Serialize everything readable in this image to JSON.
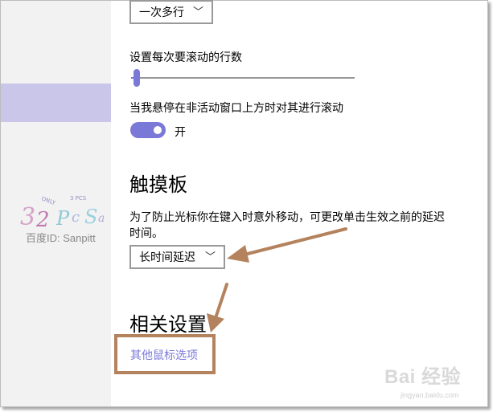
{
  "scrolling": {
    "lines_mode_value": "一次多行",
    "lines_label": "设置每次要滚动的行数",
    "lines_slider_value": 0.03,
    "inactive_scroll_label": "当我悬停在非活动窗口上方时对其进行滚动",
    "inactive_scroll_state": "开"
  },
  "touchpad": {
    "heading": "触摸板",
    "description_line1": "为了防止光标你在键入时意外移动，可更改单击生效之前的延迟",
    "description_line2": "时间。",
    "delay_value": "长时间延迟"
  },
  "related": {
    "heading": "相关设置",
    "other_mouse_options": "其他鼠标选项"
  },
  "watermark": {
    "text": "百度ID: Sanpitt",
    "logo_small": "ONLY",
    "logo_small2": "3 PCS",
    "baidu_logo": "Bai 经验",
    "baidu_url": "jingyan.baidu.com"
  },
  "colors": {
    "accent": "#7b79d8",
    "annotation": "#b4835e",
    "sidebar_selected": "#c9c6e9"
  }
}
